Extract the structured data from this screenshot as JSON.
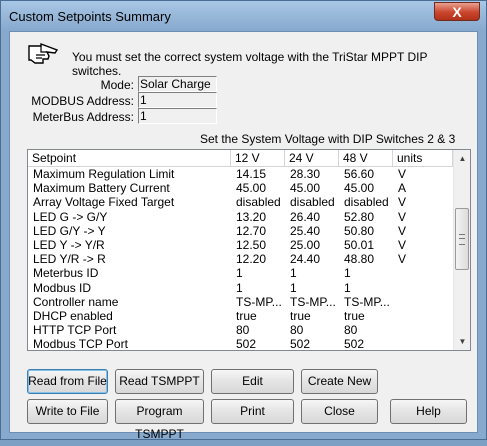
{
  "window": {
    "title": "Custom Setpoints Summary",
    "close_label": "X"
  },
  "message": "You must set the correct system voltage with the TriStar MPPT DIP switches.",
  "info": {
    "mode_label": "Mode:",
    "mode_value": "Solar Charge",
    "modbus_label": "MODBUS Address:",
    "modbus_value": "1",
    "meterbus_label": "MeterBus Address:",
    "meterbus_value": "1"
  },
  "dip_caption": "Set the System Voltage with DIP Switches 2 & 3",
  "table": {
    "columns": [
      "Setpoint",
      "12 V",
      "24 V",
      "48 V",
      "units"
    ],
    "rows": [
      [
        "Maximum Regulation Limit",
        "14.15",
        "28.30",
        "56.60",
        "V"
      ],
      [
        "Maximum Battery Current",
        "45.00",
        "45.00",
        "45.00",
        "A"
      ],
      [
        "Array Voltage Fixed Target",
        "disabled",
        "disabled",
        "disabled",
        "V"
      ],
      [
        "LED G -> G/Y",
        "13.20",
        "26.40",
        "52.80",
        "V"
      ],
      [
        "LED G/Y -> Y",
        "12.70",
        "25.40",
        "50.80",
        "V"
      ],
      [
        "LED Y -> Y/R",
        "12.50",
        "25.00",
        "50.01",
        "V"
      ],
      [
        "LED Y/R -> R",
        "12.20",
        "24.40",
        "48.80",
        "V"
      ],
      [
        "Meterbus ID",
        "1",
        "1",
        "1",
        ""
      ],
      [
        "Modbus ID",
        "1",
        "1",
        "1",
        ""
      ],
      [
        "Controller name",
        "TS-MP...",
        "TS-MP...",
        "TS-MP...",
        ""
      ],
      [
        "DHCP enabled",
        "true",
        "true",
        "true",
        ""
      ],
      [
        "HTTP TCP Port",
        "80",
        "80",
        "80",
        ""
      ],
      [
        "Modbus TCP Port",
        "502",
        "502",
        "502",
        ""
      ]
    ]
  },
  "buttons": {
    "read_from_file": "Read from File",
    "read_tsmppt": "Read TSMPPT",
    "edit": "Edit",
    "create_new": "Create New",
    "write_to_file": "Write to File",
    "program_tsmppt": "Program TSMPPT",
    "print": "Print",
    "close": "Close",
    "help": "Help"
  }
}
